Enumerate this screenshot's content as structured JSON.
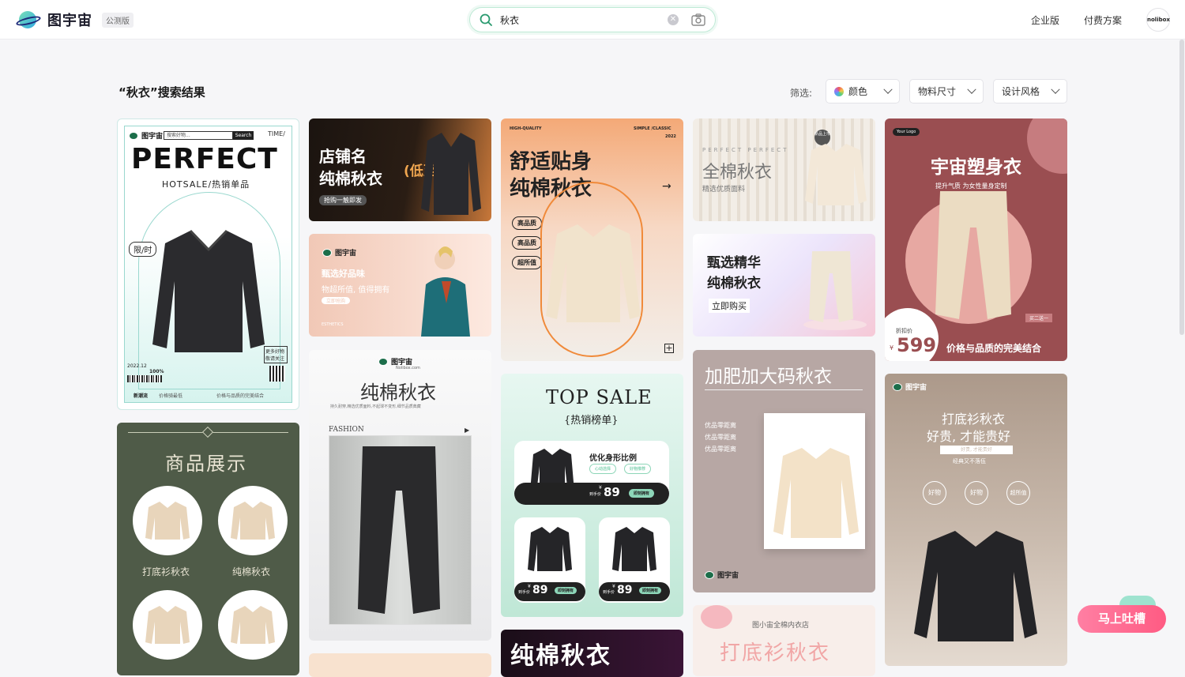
{
  "header": {
    "logo_text": "图宇宙",
    "beta_badge": "公测版",
    "search_value": "秋衣",
    "nav": [
      "企业版",
      "付费方案"
    ],
    "avatar_text": "nolibox"
  },
  "results": {
    "title": "“秋衣”搜索结果",
    "filter_label": "筛选:",
    "filters": [
      "颜色",
      "物料尺寸",
      "设计风格"
    ]
  },
  "cards": {
    "c1": {
      "logo": "图宇宙",
      "search_placeholder": "搜索好物...",
      "search_btn": "Search",
      "time": "TIME/",
      "headline": "PERFECT",
      "sub": "HOTSALE/热销单品",
      "limit": "限/时",
      "side_text": "更多好物 敬请关注",
      "date": "2022.12",
      "percent": "100%",
      "foot_left": "新潮流",
      "foot_mid": "价格骑最低",
      "foot_right": "价格与品质的完美结合"
    },
    "c2": {
      "title_line1": "店铺名",
      "title_line2": "纯棉秋衣",
      "promo": "(低至5折!",
      "tag": "抢购一触即发"
    },
    "c3": {
      "tag_left": "HIGH-QUALITY",
      "tag_right": "SIMPLE /CLASSIC",
      "year": "2022",
      "title_line1": "舒适贴身",
      "title_line2": "纯棉秋衣",
      "pills": [
        "高品质",
        "高品质",
        "超所值"
      ]
    },
    "c4": {
      "letters": "PERFECT PERFECT",
      "title": "全棉秋衣",
      "sub": "精选优质面料",
      "badge": "新品上市"
    },
    "c5": {
      "title": "宇宙塑身衣",
      "sub": "提升气质 为女性量身定制",
      "logo": "Your Logo",
      "badge": "买二送一",
      "price_label": "折扣价",
      "currency": "¥",
      "price": "599",
      "slogan": "价格与品质的完美结合"
    },
    "c6": {
      "logo": "图宇宙",
      "line1": "甄选好品味",
      "line2": "物超所值, 值得拥有",
      "btn": "立即抢购",
      "foot": "ESTHETICS"
    },
    "c7": {
      "title_line1": "甄选精华",
      "title_line2": "纯棉秋衣",
      "btn": "立即购买"
    },
    "c8": {
      "logo": "图宇宙",
      "logo_sub": "Nolibox.com",
      "title": "纯棉秋衣",
      "sub": "持久耐穿,精选优质面料,不起球不变形,细节品质典藏",
      "label": "FASHION"
    },
    "c9": {
      "title": "TOP SALE",
      "sub": "{热销榜单}",
      "item_title": "优化身形比例",
      "tags": [
        "心动选择",
        "好物推荐"
      ],
      "price_label": "到手价",
      "currency": "¥",
      "price": "89",
      "btn": "即刻拥有"
    },
    "c10": {
      "title": "加肥加大码秋衣",
      "lines": [
        "优品零距离",
        "优品零距离",
        "优品零距离"
      ],
      "logo": "图宇宙"
    },
    "c11": {
      "title_line1": "商品展示",
      "labels": [
        "打底衫秋衣",
        "纯棉秋衣"
      ]
    },
    "c12": {
      "logo": "图宇宙",
      "title_line1": "打底衫秋衣",
      "title_line2": "好贵, 才能贵好",
      "banner": "好贵, 才能贵好",
      "sub": "经典又不落伍",
      "circles": [
        "好物",
        "好物",
        "超所值"
      ]
    },
    "c13": {
      "title": "纯棉秋衣"
    },
    "c14": {
      "shop": "图小宙全棉内衣店",
      "title": "打底衫秋衣"
    }
  },
  "feedback": {
    "label": "马上吐槽"
  },
  "colors": {
    "accent_green": "#1c6e4a",
    "feedback_pink": "#ff6b8f"
  }
}
